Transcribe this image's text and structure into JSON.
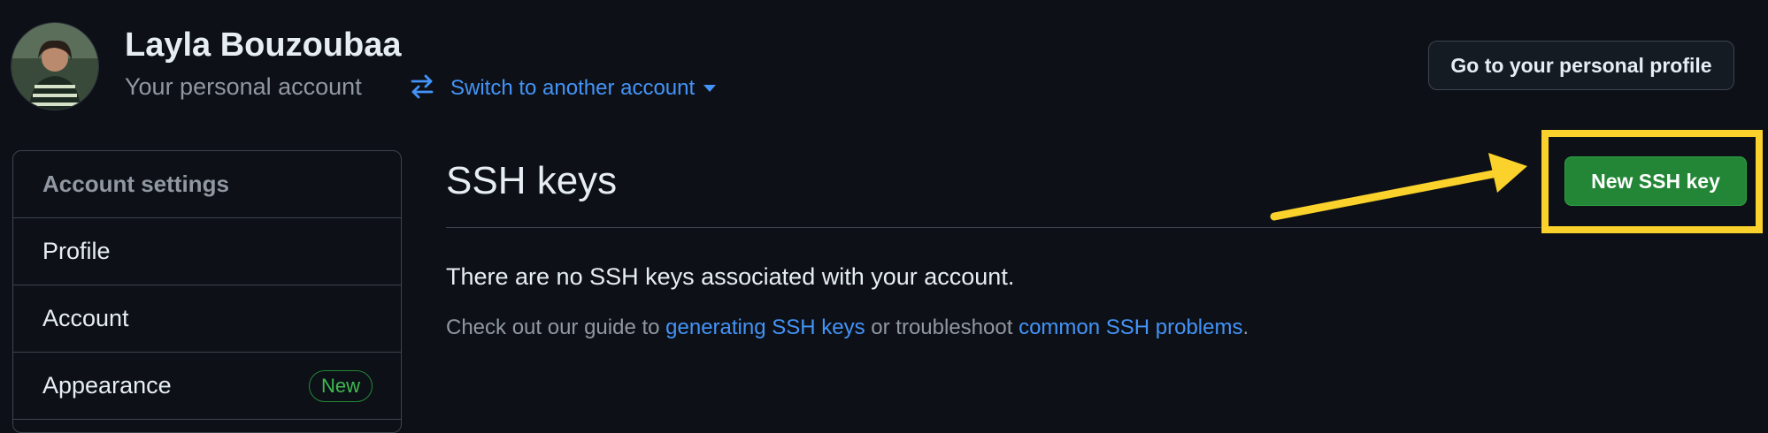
{
  "header": {
    "user_name": "Layla Bouzoubaa",
    "account_type": "Your personal account",
    "switch_account_label": "Switch to another account",
    "profile_button_label": "Go to your personal profile"
  },
  "sidebar": {
    "section_title": "Account settings",
    "items": [
      {
        "label": "Profile"
      },
      {
        "label": "Account"
      },
      {
        "label": "Appearance",
        "badge": "New"
      }
    ]
  },
  "main": {
    "title": "SSH keys",
    "new_key_button_label": "New SSH key",
    "empty_message": "There are no SSH keys associated with your account.",
    "guide": {
      "prefix": "Check out our guide to ",
      "link1": "generating SSH keys",
      "middle": " or troubleshoot ",
      "link2": "common SSH problems",
      "suffix": "."
    }
  },
  "annotation": {
    "highlight_color": "#fbd12b"
  },
  "colors": {
    "background": "#0d1117",
    "accent": "#4493f8",
    "primary_button": "#238636"
  }
}
